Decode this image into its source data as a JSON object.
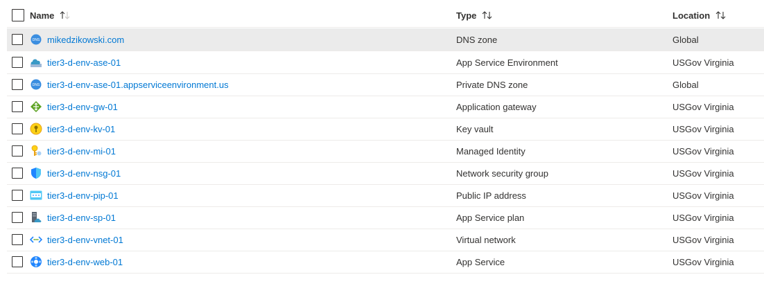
{
  "header": {
    "name_label": "Name",
    "type_label": "Type",
    "location_label": "Location"
  },
  "colors": {
    "link": "#0078d4",
    "selected_row": "#ebebeb"
  },
  "rows": [
    {
      "name": "mikedzikowski.com",
      "type": "DNS zone",
      "location": "Global",
      "icon": "dns-zone-icon",
      "selected": true
    },
    {
      "name": "tier3-d-env-ase-01",
      "type": "App Service Environment",
      "location": "USGov Virginia",
      "icon": "app-service-environment-icon"
    },
    {
      "name": "tier3-d-env-ase-01.appserviceenvironment.us",
      "type": "Private DNS zone",
      "location": "Global",
      "icon": "private-dns-zone-icon"
    },
    {
      "name": "tier3-d-env-gw-01",
      "type": "Application gateway",
      "location": "USGov Virginia",
      "icon": "application-gateway-icon"
    },
    {
      "name": "tier3-d-env-kv-01",
      "type": "Key vault",
      "location": "USGov Virginia",
      "icon": "key-vault-icon"
    },
    {
      "name": "tier3-d-env-mi-01",
      "type": "Managed Identity",
      "location": "USGov Virginia",
      "icon": "managed-identity-icon"
    },
    {
      "name": "tier3-d-env-nsg-01",
      "type": "Network security group",
      "location": "USGov Virginia",
      "icon": "network-security-group-icon"
    },
    {
      "name": "tier3-d-env-pip-01",
      "type": "Public IP address",
      "location": "USGov Virginia",
      "icon": "public-ip-icon"
    },
    {
      "name": "tier3-d-env-sp-01",
      "type": "App Service plan",
      "location": "USGov Virginia",
      "icon": "app-service-plan-icon"
    },
    {
      "name": "tier3-d-env-vnet-01",
      "type": "Virtual network",
      "location": "USGov Virginia",
      "icon": "virtual-network-icon"
    },
    {
      "name": "tier3-d-env-web-01",
      "type": "App Service",
      "location": "USGov Virginia",
      "icon": "app-service-icon"
    }
  ]
}
